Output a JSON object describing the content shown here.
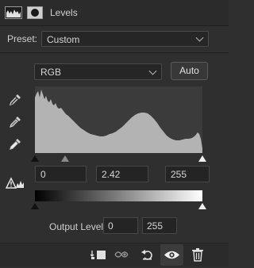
{
  "panel": {
    "title": "Levels"
  },
  "preset": {
    "label": "Preset:",
    "value": "Custom"
  },
  "channel": {
    "value": "RGB",
    "auto_label": "Auto"
  },
  "input_levels": {
    "black": "0",
    "gamma": "2.42",
    "white": "255"
  },
  "output_levels": {
    "label": "Output Levels:",
    "black": "0",
    "white": "255"
  },
  "icons": {
    "header": [
      "levels-icon",
      "mask-icon"
    ],
    "eyedroppers": [
      "black-eyedropper-icon",
      "gray-eyedropper-icon",
      "white-eyedropper-icon"
    ],
    "footer": [
      "clip-to-layer-icon",
      "view-previous-state-icon",
      "reset-icon",
      "visibility-eye-icon",
      "delete-trash-icon"
    ]
  },
  "colors": {
    "panel_bg": "#2f2f2f",
    "histogram_bg": "#3b3b3b",
    "histogram_fill": "#b3b3b3"
  }
}
